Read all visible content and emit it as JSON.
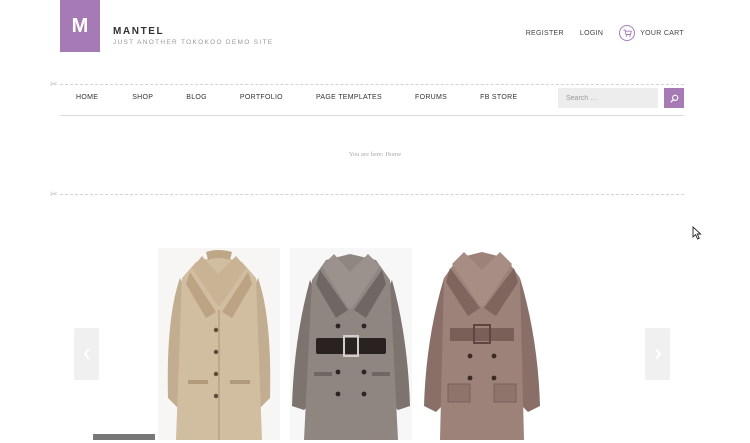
{
  "header": {
    "logo_letter": "M",
    "brand_name": "MANTEL",
    "tagline": "JUST ANOTHER TOKOKOO DEMO SITE",
    "register": "REGISTER",
    "login": "LOGIN",
    "cart": "YOUR CART"
  },
  "nav": {
    "items": [
      "HOME",
      "SHOP",
      "BLOG",
      "PORTFOLIO",
      "PAGE TEMPLATES",
      "FORUMS",
      "FB STORE"
    ],
    "search_placeholder": "Search …"
  },
  "breadcrumb": "You are here: Home",
  "slider": {
    "products": [
      "beige-tweed-coat",
      "grey-belted-trench-coat",
      "brown-belted-coat"
    ],
    "prev_icon": "chevron-left-icon",
    "next_icon": "chevron-right-icon"
  },
  "colors": {
    "accent": "#a67bb5"
  }
}
